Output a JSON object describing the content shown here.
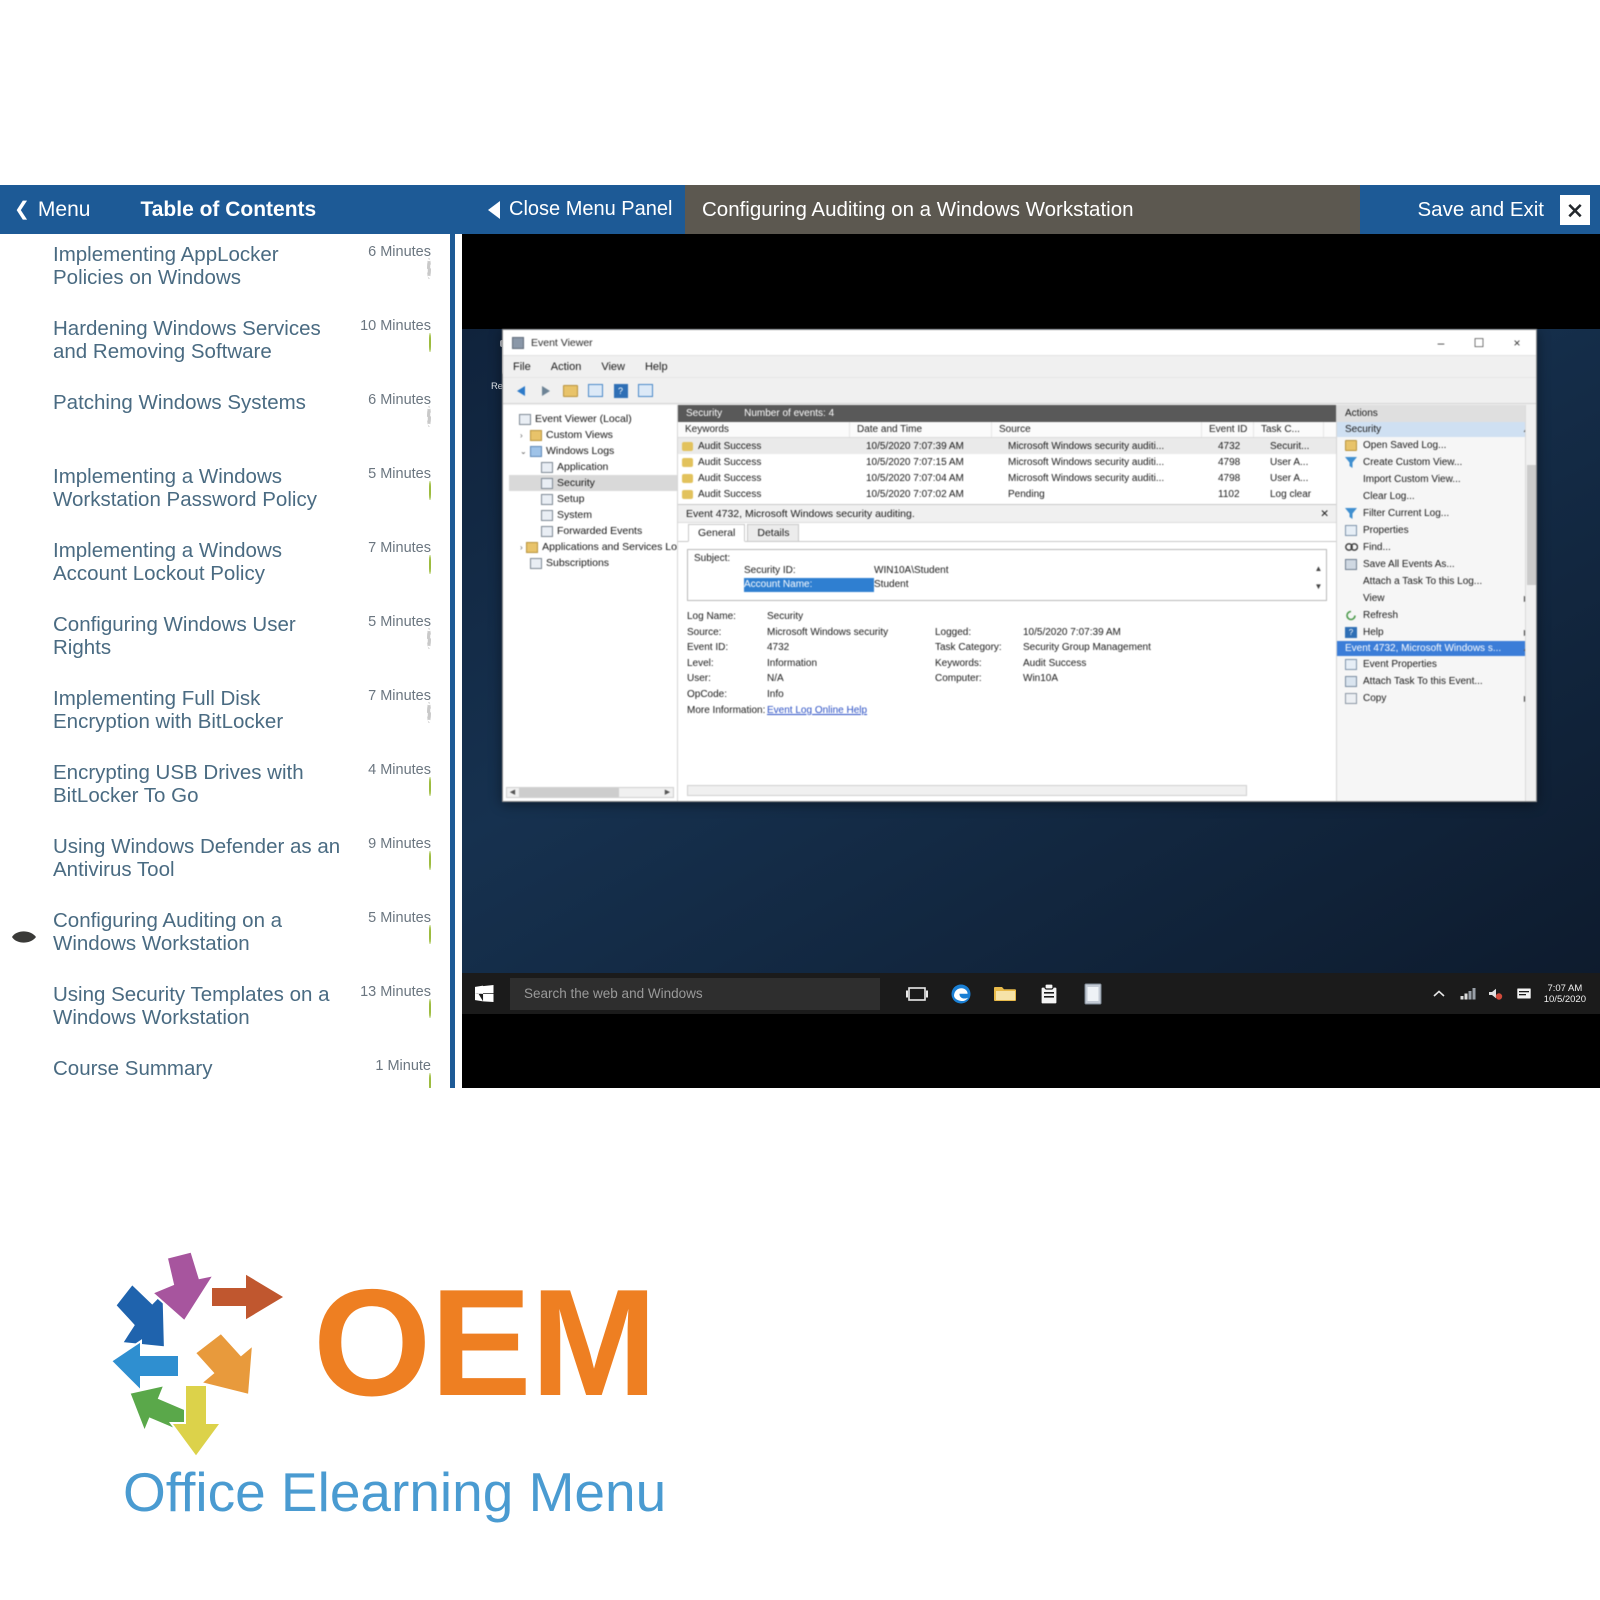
{
  "topbar": {
    "menu_label": "Menu",
    "menu_chevron": "chevron-left-icon",
    "toc_title": "Table of Contents",
    "close_panel_label": "Close Menu Panel",
    "lesson_title": "Configuring Auditing on a Windows Workstation",
    "save_exit_label": "Save and Exit",
    "close_icon": "close-x-icon",
    "colors": {
      "blue": "#1d5a96",
      "lesson_bg": "#5c5850"
    }
  },
  "toc": {
    "items": [
      {
        "label": "Implementing AppLocker Policies on Windows",
        "duration": "6 Minutes",
        "status": "todo",
        "current": false
      },
      {
        "label": "Hardening Windows Services and Removing Software",
        "duration": "10 Minutes",
        "status": "done",
        "current": false
      },
      {
        "label": "Patching Windows Systems",
        "duration": "6 Minutes",
        "status": "todo",
        "current": false
      },
      {
        "label": "Implementing a Windows Workstation Password Policy",
        "duration": "5 Minutes",
        "status": "done",
        "current": false
      },
      {
        "label": "Implementing a Windows Account Lockout Policy",
        "duration": "7 Minutes",
        "status": "done",
        "current": false
      },
      {
        "label": "Configuring Windows User Rights",
        "duration": "5 Minutes",
        "status": "todo",
        "current": false
      },
      {
        "label": "Implementing Full Disk Encryption with BitLocker",
        "duration": "7 Minutes",
        "status": "todo",
        "current": false
      },
      {
        "label": "Encrypting USB Drives with BitLocker To Go",
        "duration": "4 Minutes",
        "status": "done",
        "current": false
      },
      {
        "label": "Using Windows Defender as an Antivirus Tool",
        "duration": "9 Minutes",
        "status": "done",
        "current": false
      },
      {
        "label": "Configuring Auditing on a Windows Workstation",
        "duration": "5 Minutes",
        "status": "done",
        "current": true
      },
      {
        "label": "Using Security Templates on a Windows Workstation",
        "duration": "13 Minutes",
        "status": "done",
        "current": false
      },
      {
        "label": "Course Summary",
        "duration": "1 Minute",
        "status": "done",
        "current": false
      }
    ],
    "colors": {
      "label": "#4a6b82",
      "done": "#b3d250",
      "todo_border": "#c9c9c9"
    }
  },
  "slide": {
    "desktop": {
      "recycle_bin_label": "Recycle Bin"
    },
    "event_viewer": {
      "window_title": "Event Viewer",
      "window_buttons": {
        "minimize": "–",
        "maximize": "☐",
        "close": "×"
      },
      "menus": [
        "File",
        "Action",
        "View",
        "Help"
      ],
      "toolbar_icons": [
        "back-arrow-icon",
        "forward-arrow-icon",
        "up-folder-icon",
        "show-hide-pane-icon",
        "help-icon",
        "properties-icon"
      ],
      "tree": [
        {
          "label": "Event Viewer (Local)",
          "indent": 0,
          "expander": "",
          "icon": "console-icon",
          "selected": false
        },
        {
          "label": "Custom Views",
          "indent": 1,
          "expander": "›",
          "icon": "folder-icon",
          "selected": false
        },
        {
          "label": "Windows Logs",
          "indent": 1,
          "expander": "⌄",
          "icon": "logs-icon",
          "selected": false
        },
        {
          "label": "Application",
          "indent": 2,
          "expander": "",
          "icon": "log-icon",
          "selected": false
        },
        {
          "label": "Security",
          "indent": 2,
          "expander": "",
          "icon": "log-icon",
          "selected": true
        },
        {
          "label": "Setup",
          "indent": 2,
          "expander": "",
          "icon": "log-icon",
          "selected": false
        },
        {
          "label": "System",
          "indent": 2,
          "expander": "",
          "icon": "log-icon",
          "selected": false
        },
        {
          "label": "Forwarded Events",
          "indent": 2,
          "expander": "",
          "icon": "log-icon",
          "selected": false
        },
        {
          "label": "Applications and Services Lo",
          "indent": 1,
          "expander": "›",
          "icon": "folder-icon",
          "selected": false
        },
        {
          "label": "Subscriptions",
          "indent": 1,
          "expander": "",
          "icon": "console-icon",
          "selected": false
        }
      ],
      "list_caption": {
        "log": "Security",
        "count": "Number of events: 4"
      },
      "columns": [
        "Keywords",
        "Date and Time",
        "Source",
        "Event ID",
        "Task C..."
      ],
      "rows": [
        {
          "keywords": "Audit Success",
          "datetime": "10/5/2020 7:07:39 AM",
          "source": "Microsoft Windows security auditi...",
          "event_id": "4732",
          "task": "Securit...",
          "selected": true
        },
        {
          "keywords": "Audit Success",
          "datetime": "10/5/2020 7:07:15 AM",
          "source": "Microsoft Windows security auditi...",
          "event_id": "4798",
          "task": "User A...",
          "selected": false
        },
        {
          "keywords": "Audit Success",
          "datetime": "10/5/2020 7:07:04 AM",
          "source": "Microsoft Windows security auditi...",
          "event_id": "4798",
          "task": "User A...",
          "selected": false
        },
        {
          "keywords": "Audit Success",
          "datetime": "10/5/2020 7:07:02 AM",
          "source": "Pending",
          "event_id": "1102",
          "task": "Log clear",
          "selected": false
        }
      ],
      "detail": {
        "header": "Event 4732, Microsoft Windows security auditing.",
        "close_icon": "close-icon",
        "tabs": [
          {
            "label": "General",
            "active": true
          },
          {
            "label": "Details",
            "active": false
          }
        ],
        "subject_title": "Subject:",
        "subject_rows": [
          {
            "key": "Security ID:",
            "value": "WIN10A\\Student",
            "highlight": false
          },
          {
            "key": "Account Name:",
            "value": "Student",
            "highlight": true
          }
        ],
        "fields": [
          {
            "k": "Log Name:",
            "v": "Security",
            "k2": "",
            "v2": ""
          },
          {
            "k": "Source:",
            "v": "Microsoft Windows security",
            "k2": "Logged:",
            "v2": "10/5/2020 7:07:39 AM"
          },
          {
            "k": "Event ID:",
            "v": "4732",
            "k2": "Task Category:",
            "v2": "Security Group Management"
          },
          {
            "k": "Level:",
            "v": "Information",
            "k2": "Keywords:",
            "v2": "Audit Success"
          },
          {
            "k": "User:",
            "v": "N/A",
            "k2": "Computer:",
            "v2": "Win10A"
          },
          {
            "k": "OpCode:",
            "v": "Info",
            "k2": "",
            "v2": ""
          }
        ],
        "more_info_label": "More Information:",
        "more_info_link": "Event Log Online Help"
      },
      "actions": {
        "caption": "Actions",
        "section_security": "Security",
        "items": [
          {
            "label": "Open Saved Log...",
            "icon": "open-log-icon",
            "submenu": false
          },
          {
            "label": "Create Custom View...",
            "icon": "filter-icon",
            "submenu": false
          },
          {
            "label": "Import Custom View...",
            "icon": "",
            "submenu": false
          },
          {
            "label": "Clear Log...",
            "icon": "",
            "submenu": false
          },
          {
            "label": "Filter Current Log...",
            "icon": "filter-icon",
            "submenu": false
          },
          {
            "label": "Properties",
            "icon": "properties-icon",
            "submenu": false
          },
          {
            "label": "Find...",
            "icon": "find-icon",
            "submenu": false
          },
          {
            "label": "Save All Events As...",
            "icon": "save-icon",
            "submenu": false
          },
          {
            "label": "Attach a Task To this Log...",
            "icon": "",
            "submenu": false
          },
          {
            "label": "View",
            "icon": "",
            "submenu": true
          },
          {
            "label": "Refresh",
            "icon": "refresh-icon",
            "submenu": false
          },
          {
            "label": "Help",
            "icon": "help-icon",
            "submenu": true
          }
        ],
        "section_event": "Event 4732, Microsoft Windows s...",
        "event_items": [
          {
            "label": "Event Properties",
            "icon": "properties-icon",
            "submenu": false
          },
          {
            "label": "Attach Task To this Event...",
            "icon": "task-icon",
            "submenu": false
          },
          {
            "label": "Copy",
            "icon": "copy-icon",
            "submenu": true
          }
        ]
      }
    },
    "taskbar": {
      "start_icon": "windows-start-icon",
      "search_placeholder": "Search the web and Windows",
      "pinned": [
        "task-view-icon",
        "edge-browser-icon",
        "file-explorer-icon",
        "store-icon",
        "event-viewer-icon"
      ],
      "tray_icons": [
        "show-hidden-icons-icon",
        "network-icon",
        "volume-icon",
        "action-center-icon"
      ],
      "clock_time": "7:07 AM",
      "clock_date": "10/5/2020"
    }
  },
  "logo": {
    "word": "OEM",
    "subtitle": "Office Elearning Menu",
    "colors": {
      "word": "#ee7f22",
      "subtitle": "#4a9bd1"
    },
    "arrow_colors": [
      "#1f63ad",
      "#a7559e",
      "#c0572f",
      "#2f8fd0",
      "#e89a3c",
      "#5aa84a",
      "#dcd24a"
    ]
  }
}
